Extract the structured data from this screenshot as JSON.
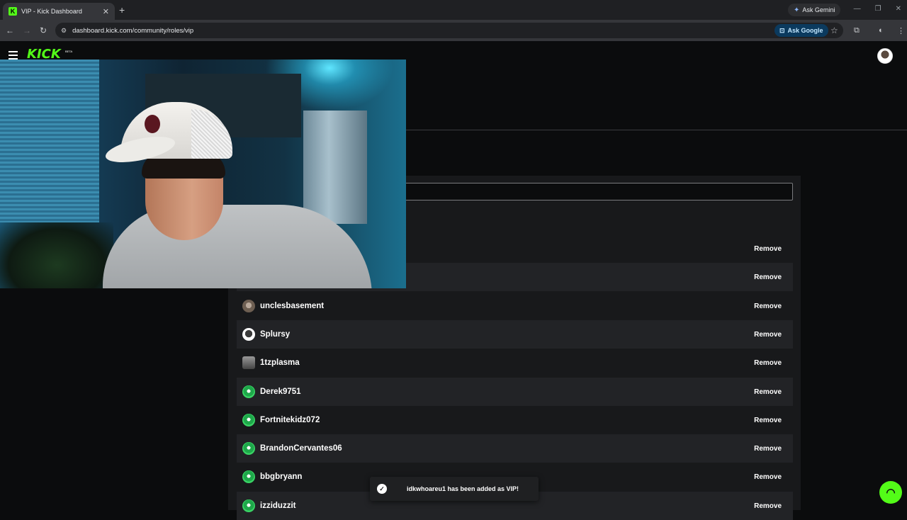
{
  "browser": {
    "tab_title": "VIP - Kick Dashboard",
    "url": "dashboard.kick.com/community/roles/vip",
    "ask_gemini": "Ask Gemini",
    "ask_google": "Ask Google"
  },
  "app": {
    "logo": "KICK",
    "logo_badge": "BETA",
    "brand_color": "#53fc18"
  },
  "vips": {
    "remove_label": "Remove",
    "rows": [
      {
        "username": "",
        "avatar": "hidden"
      },
      {
        "username": "",
        "avatar": "hidden"
      },
      {
        "username": "unclesbasement",
        "avatar": "brown"
      },
      {
        "username": "Splursy",
        "avatar": "white"
      },
      {
        "username": "1tzplasma",
        "avatar": "sq"
      },
      {
        "username": "Derek9751",
        "avatar": "green"
      },
      {
        "username": "Fortnitekidz072",
        "avatar": "green"
      },
      {
        "username": "BrandonCervantes06",
        "avatar": "green"
      },
      {
        "username": "bbgbryann",
        "avatar": "green"
      },
      {
        "username": "izziduzzit",
        "avatar": "green"
      }
    ]
  },
  "toast": {
    "message": "idkwhoareu1 has been added as VIP!"
  }
}
